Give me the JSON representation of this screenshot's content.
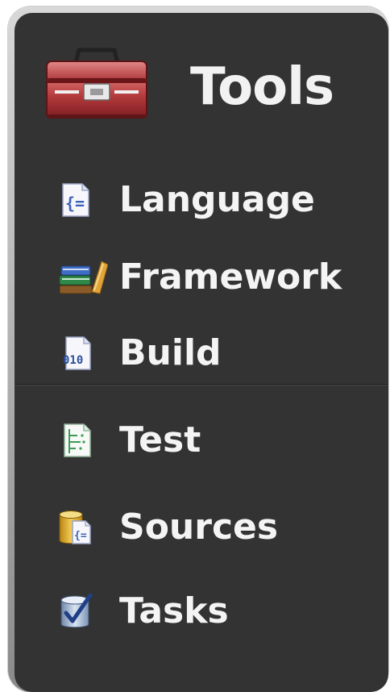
{
  "panel": {
    "title": "Tools",
    "title_icon": "toolbox-icon"
  },
  "menu": {
    "items": [
      {
        "label": "Language",
        "icon": "curly-brace-document-icon"
      },
      {
        "label": "Framework",
        "icon": "books-icon"
      },
      {
        "label": "Build",
        "icon": "binary-document-icon"
      },
      {
        "label": "Test",
        "icon": "test-list-document-icon"
      },
      {
        "label": "Sources",
        "icon": "source-database-icon"
      },
      {
        "label": "Tasks",
        "icon": "task-checklist-icon"
      }
    ]
  },
  "colors": {
    "panel_background": "#333333",
    "text": "#f4f4f4",
    "toolbox_red": "#b3393b"
  }
}
